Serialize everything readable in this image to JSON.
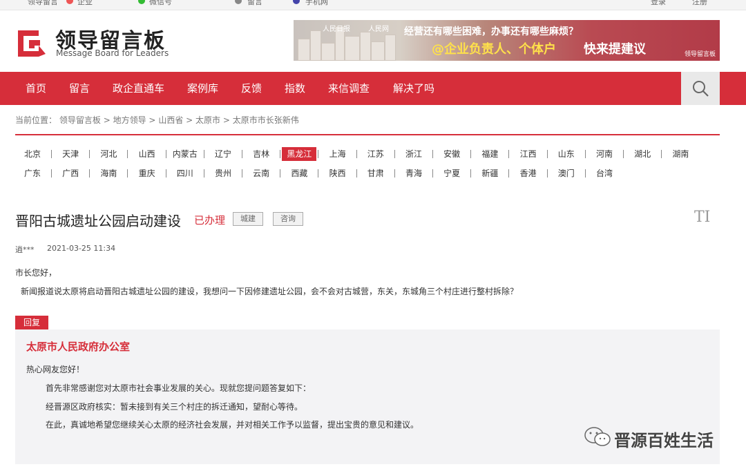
{
  "topbar": {
    "links": [
      "领导留言",
      "企业",
      "微信号",
      "留言",
      "手机网",
      "登录",
      "注册"
    ]
  },
  "header": {
    "logo_cn": "领导留言板",
    "logo_en": "Message Board for Leaders",
    "banner_line1": "经营还有哪些困难，办事还有哪些麻烦？",
    "banner_line2a": "@企业负责人、个体户",
    "banner_line2b": "快来提建议",
    "banner_logo1": "人民日报",
    "banner_logo2": "人民网",
    "banner_brand": "领导留言板"
  },
  "nav": {
    "items": [
      "首页",
      "留言",
      "政企直通车",
      "案例库",
      "反馈",
      "指数",
      "来信调查",
      "解决了吗"
    ],
    "search_icon": "search-icon"
  },
  "breadcrumb": {
    "prefix": "当前位置：",
    "items": [
      "领导留言板",
      "地方领导",
      "山西省",
      "太原市",
      "太原市市长张新伟"
    ],
    "separator": ">"
  },
  "provinces": {
    "row1": [
      "北京",
      "天津",
      "河北",
      "山西",
      "内蒙古",
      "辽宁",
      "吉林",
      "黑龙江",
      "上海",
      "江苏",
      "浙江",
      "安徽",
      "福建",
      "江西",
      "山东",
      "河南",
      "湖北",
      "湖南"
    ],
    "row2": [
      "广东",
      "广西",
      "海南",
      "重庆",
      "四川",
      "贵州",
      "云南",
      "西藏",
      "陕西",
      "甘肃",
      "青海",
      "宁夏",
      "新疆",
      "香港",
      "澳门",
      "台湾"
    ],
    "active": "黑龙江"
  },
  "message": {
    "title": "晋阳古城遗址公园启动建设",
    "status": "已办理",
    "tags": [
      "城建",
      "咨询"
    ],
    "author": "逍***",
    "time": "2021-03-25 11:34",
    "greeting": "市长您好，",
    "content": "新闻报道说太原将启动晋阳古城遗址公园的建设，我想问一下因修建遗址公园，会不会对古城营，东关，东城角三个村庄进行整村拆除？"
  },
  "reply": {
    "badge": "回复",
    "org": "太原市人民政府办公室",
    "lines": [
      "热心网友您好！",
      "首先非常感谢您对太原市社会事业发展的关心。现就您提问题答复如下：",
      "经晋源区政府核实：暂未接到有关三个村庄的拆迁通知，望耐心等待。",
      "在此，真诚地希望您继续关心太原的经济社会发展，并对相关工作予以监督，提出宝贵的意见和建议。"
    ]
  },
  "watermark": {
    "text": "晋源百姓生活"
  },
  "colors": {
    "brand_red": "#d62e3a",
    "reply_bg": "#f3f3f5"
  }
}
